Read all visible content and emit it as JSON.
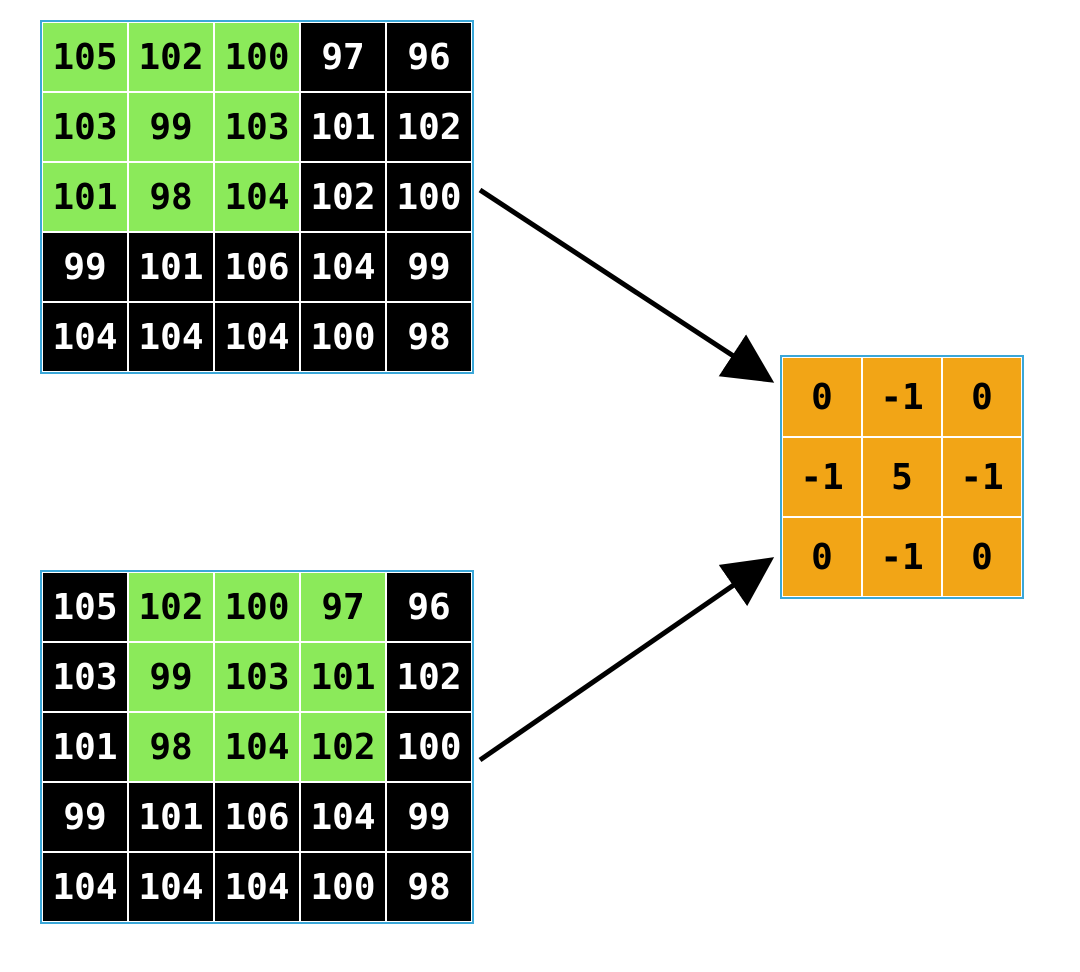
{
  "matrixA": {
    "rows": 5,
    "cols": 5,
    "values": [
      [
        105,
        102,
        100,
        97,
        96
      ],
      [
        103,
        99,
        103,
        101,
        102
      ],
      [
        101,
        98,
        104,
        102,
        100
      ],
      [
        99,
        101,
        106,
        104,
        99
      ],
      [
        104,
        104,
        104,
        100,
        98
      ]
    ],
    "highlight": [
      [
        0,
        0
      ],
      [
        0,
        1
      ],
      [
        0,
        2
      ],
      [
        1,
        0
      ],
      [
        1,
        1
      ],
      [
        1,
        2
      ],
      [
        2,
        0
      ],
      [
        2,
        1
      ],
      [
        2,
        2
      ]
    ]
  },
  "matrixB": {
    "rows": 5,
    "cols": 5,
    "values": [
      [
        105,
        102,
        100,
        97,
        96
      ],
      [
        103,
        99,
        103,
        101,
        102
      ],
      [
        101,
        98,
        104,
        102,
        100
      ],
      [
        99,
        101,
        106,
        104,
        99
      ],
      [
        104,
        104,
        104,
        100,
        98
      ]
    ],
    "highlight": [
      [
        0,
        1
      ],
      [
        0,
        2
      ],
      [
        0,
        3
      ],
      [
        1,
        1
      ],
      [
        1,
        2
      ],
      [
        1,
        3
      ],
      [
        2,
        1
      ],
      [
        2,
        2
      ],
      [
        2,
        3
      ]
    ]
  },
  "kernel": {
    "rows": 3,
    "cols": 3,
    "values": [
      [
        0,
        -1,
        0
      ],
      [
        -1,
        5,
        -1
      ],
      [
        0,
        -1,
        0
      ]
    ]
  },
  "colors": {
    "matrix_bg": "#000000",
    "matrix_fg": "#ffffff",
    "highlight_bg": "#8bea5a",
    "highlight_fg": "#000000",
    "kernel_bg": "#f2a516",
    "kernel_fg": "#000000",
    "border": "#3ba7d8"
  }
}
